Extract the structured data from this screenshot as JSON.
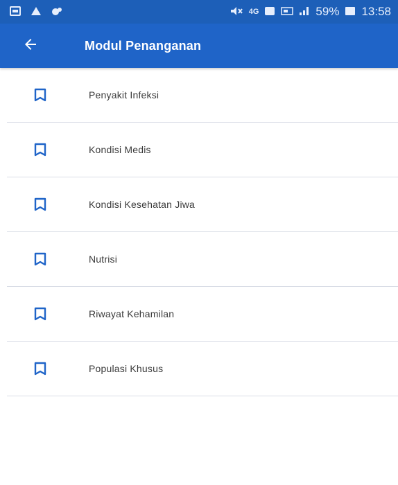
{
  "status_bar": {
    "signal_text": "59%",
    "time": "13:58",
    "network_label": "4G"
  },
  "app_bar": {
    "title": "Modul Penanganan",
    "back_icon": "arrow-left-icon"
  },
  "colors": {
    "status_bar": "#1d5fb8",
    "app_bar": "#1f64c8",
    "accent": "#1f64c8",
    "divider": "#d9dde6"
  },
  "list": {
    "item_icon": "bookmark-outline-icon",
    "items": [
      {
        "label": "Penyakit Infeksi"
      },
      {
        "label": "Kondisi Medis"
      },
      {
        "label": "Kondisi Kesehatan Jiwa"
      },
      {
        "label": "Nutrisi"
      },
      {
        "label": "Riwayat Kehamilan"
      },
      {
        "label": "Populasi Khusus"
      }
    ]
  }
}
